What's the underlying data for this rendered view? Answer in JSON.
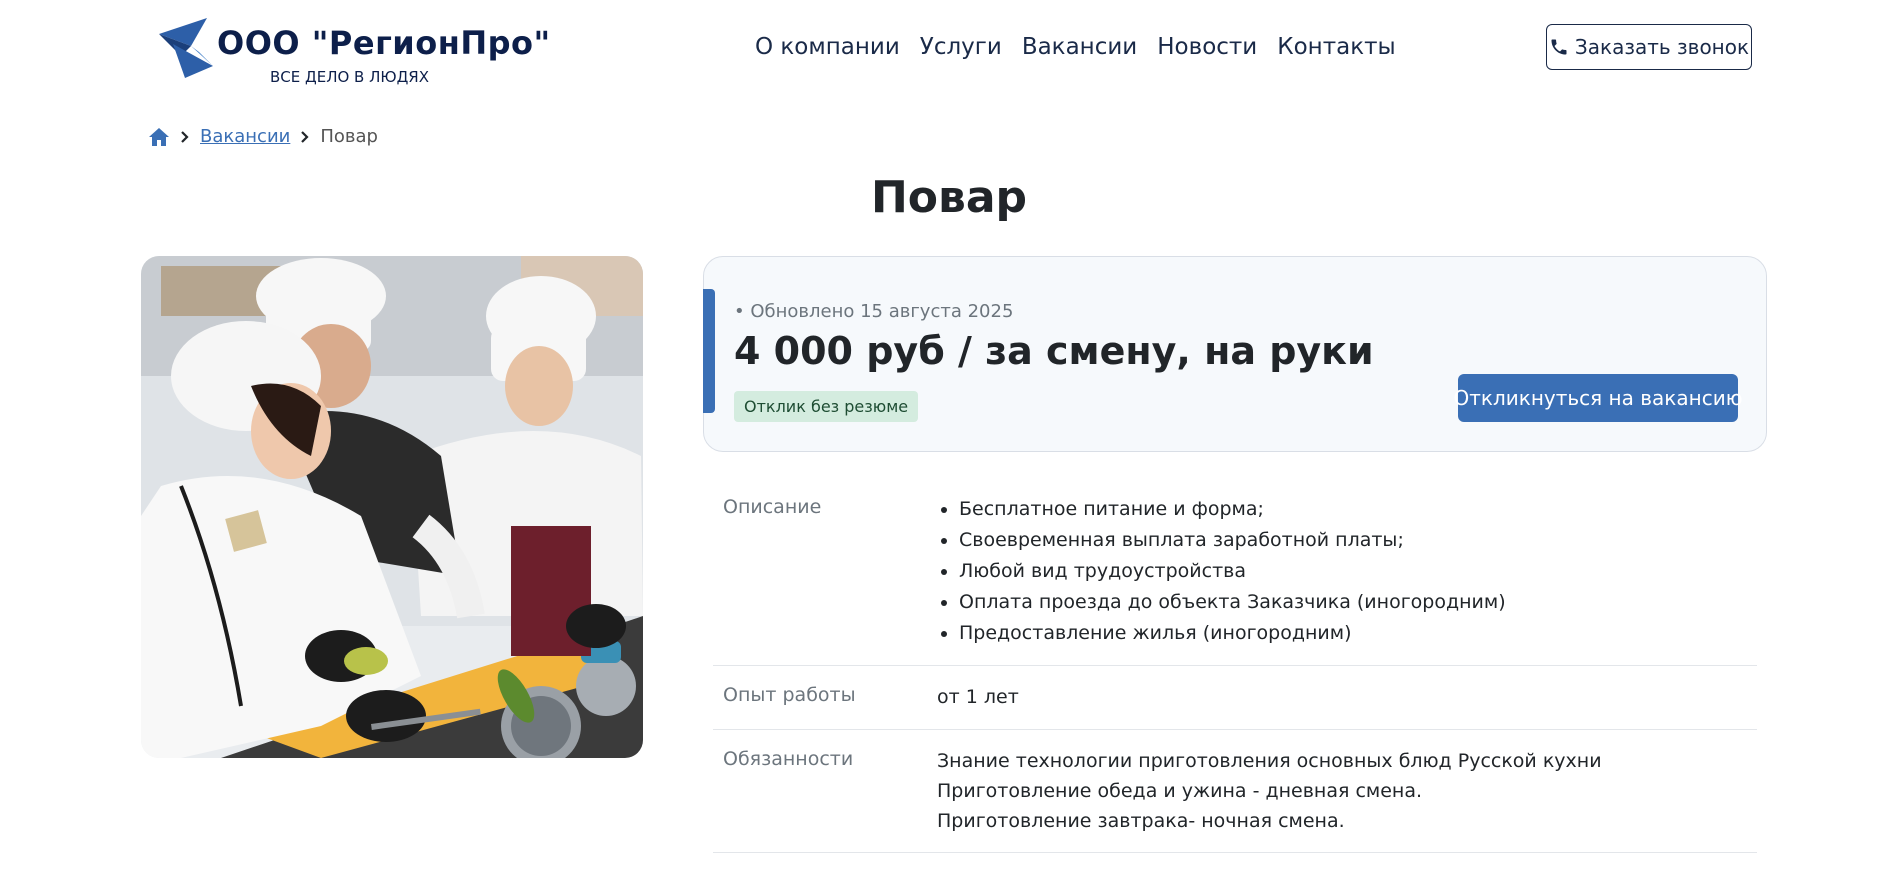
{
  "header": {
    "logo_title": "ООО \"РегионПро\"",
    "logo_subtitle": "ВСЕ ДЕЛО В ЛЮДЯХ",
    "nav": [
      "О компании",
      "Услуги",
      "Вакансии",
      "Новости",
      "Контакты"
    ],
    "call_button": "Заказать звонок",
    "colors": {
      "brand": "#0d1f4a",
      "accent": "#3a6fb5"
    }
  },
  "breadcrumb": {
    "home_icon": "home-icon",
    "link": "Вакансии",
    "current": "Повар"
  },
  "page_title": "Повар",
  "vacancy_card": {
    "updated": "• Обновлено 15 августа 2025",
    "salary": "4 000 руб / за смену, на руки",
    "badge": "Отклик без резюме",
    "apply_button": "Откликнуться на вакансию"
  },
  "details": {
    "description_label": "Описание",
    "description_items": [
      "Бесплатное питание и форма;",
      "Своевременная выплата заработной платы;",
      "Любой вид трудоустройства",
      "Оплата проезда до объекта Заказчика (иногородним)",
      "Предоставление жилья (иногородним)"
    ],
    "experience_label": "Опыт работы",
    "experience_value": "от 1 лет",
    "duties_label": "Обязанности",
    "duties_lines": [
      "Знание технологии приготовления основных блюд Русской кухни",
      "Приготовление обеда и ужина - дневная смена.",
      "Приготовление завтрака- ночная смена."
    ]
  }
}
